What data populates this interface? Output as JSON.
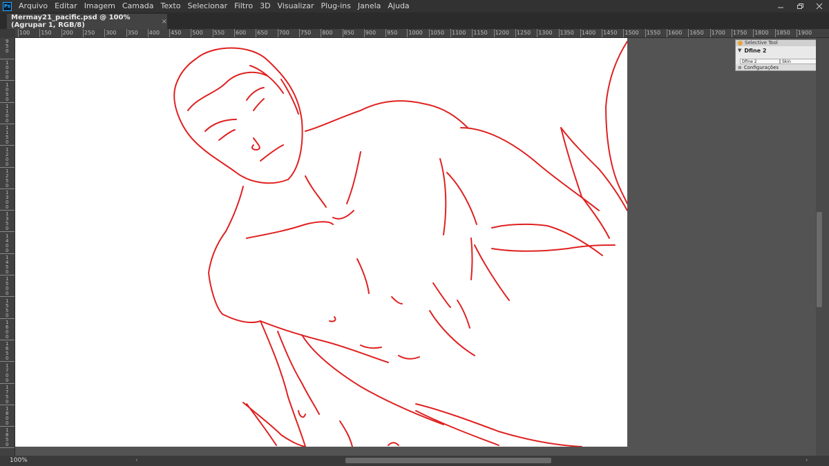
{
  "app": {
    "logo_text": "Ps",
    "menu": [
      "Arquivo",
      "Editar",
      "Imagem",
      "Camada",
      "Texto",
      "Selecionar",
      "Filtro",
      "3D",
      "Visualizar",
      "Plug-ins",
      "Janela",
      "Ajuda"
    ],
    "window_controls": [
      "minimize-icon",
      "restore-icon",
      "close-icon"
    ]
  },
  "document": {
    "tab_title": "Mermay21_pacific.psd @ 100% (Agrupar 1, RGB/8)",
    "tab_close": "×"
  },
  "rulers": {
    "top_labels": [
      "100",
      "150",
      "200",
      "250",
      "300",
      "350",
      "400",
      "450",
      "500",
      "550",
      "600",
      "650",
      "700",
      "750",
      "800",
      "850",
      "900",
      "950",
      "1000",
      "1050",
      "1100",
      "1150",
      "1200",
      "1250",
      "1300",
      "1350",
      "1400",
      "1450",
      "1500",
      "1550",
      "1600",
      "1650",
      "1700",
      "1750",
      "1800",
      "1850",
      "1900"
    ],
    "left_labels": [
      "950",
      "1000",
      "1050",
      "1100",
      "1150",
      "1200",
      "1250",
      "1300",
      "1350",
      "1400",
      "1450",
      "1500",
      "1550",
      "1600",
      "1650",
      "1700",
      "1750",
      "1800",
      "1850"
    ]
  },
  "canvas": {
    "sketch_color": "#e02020",
    "background": "#ffffff"
  },
  "panel": {
    "title": "Selective Tool",
    "heading": "Dfine 2",
    "cells": [
      "Dfine 2",
      "Skin"
    ],
    "footer": "Configurações"
  },
  "status": {
    "zoom": "100%"
  }
}
